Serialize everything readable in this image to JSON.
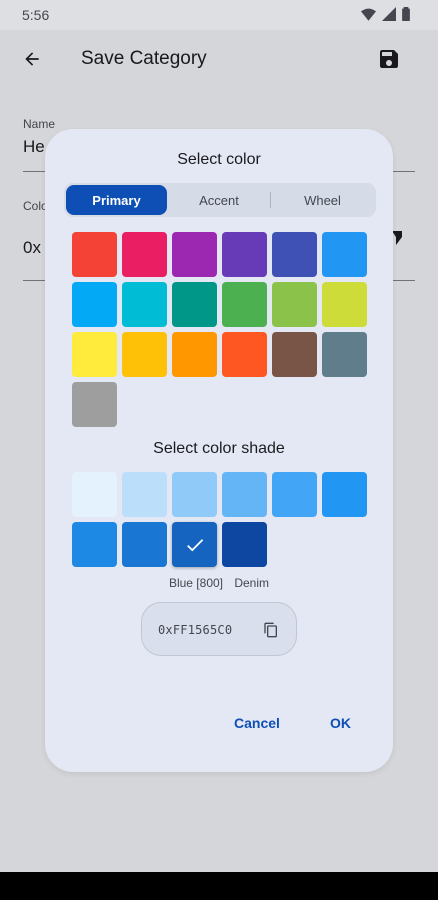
{
  "status_bar": {
    "time": "5:56"
  },
  "app_bar": {
    "title": "Save Category"
  },
  "background_form": {
    "name_label": "Name",
    "name_value": "He",
    "color_label": "Colo",
    "color_value": "0x"
  },
  "dialog": {
    "title": "Select color",
    "tabs": [
      {
        "label": "Primary",
        "selected": true
      },
      {
        "label": "Accent",
        "selected": false
      },
      {
        "label": "Wheel",
        "selected": false
      }
    ],
    "primary_colors": [
      "#f44336",
      "#e91e63",
      "#9c27b0",
      "#673ab7",
      "#3f51b5",
      "#2196f3",
      "#03a9f4",
      "#00bcd4",
      "#009688",
      "#4caf50",
      "#8bc34a",
      "#cddc39",
      "#ffeb3b",
      "#ffc107",
      "#ff9800",
      "#ff5722",
      "#795548",
      "#607d8b",
      "#9e9e9e"
    ],
    "shade_title": "Select color shade",
    "shades": [
      "#e3f2fd",
      "#bbdefb",
      "#90caf9",
      "#64b5f6",
      "#42a5f5",
      "#2196f3",
      "#1e88e5",
      "#1976d2",
      "#1565c0",
      "#0d47a1"
    ],
    "selected_shade_index": 8,
    "color_name": "Blue [800]",
    "color_alias": "Denim",
    "hex_value": "0xFF1565C0",
    "cancel_label": "Cancel",
    "ok_label": "OK"
  }
}
